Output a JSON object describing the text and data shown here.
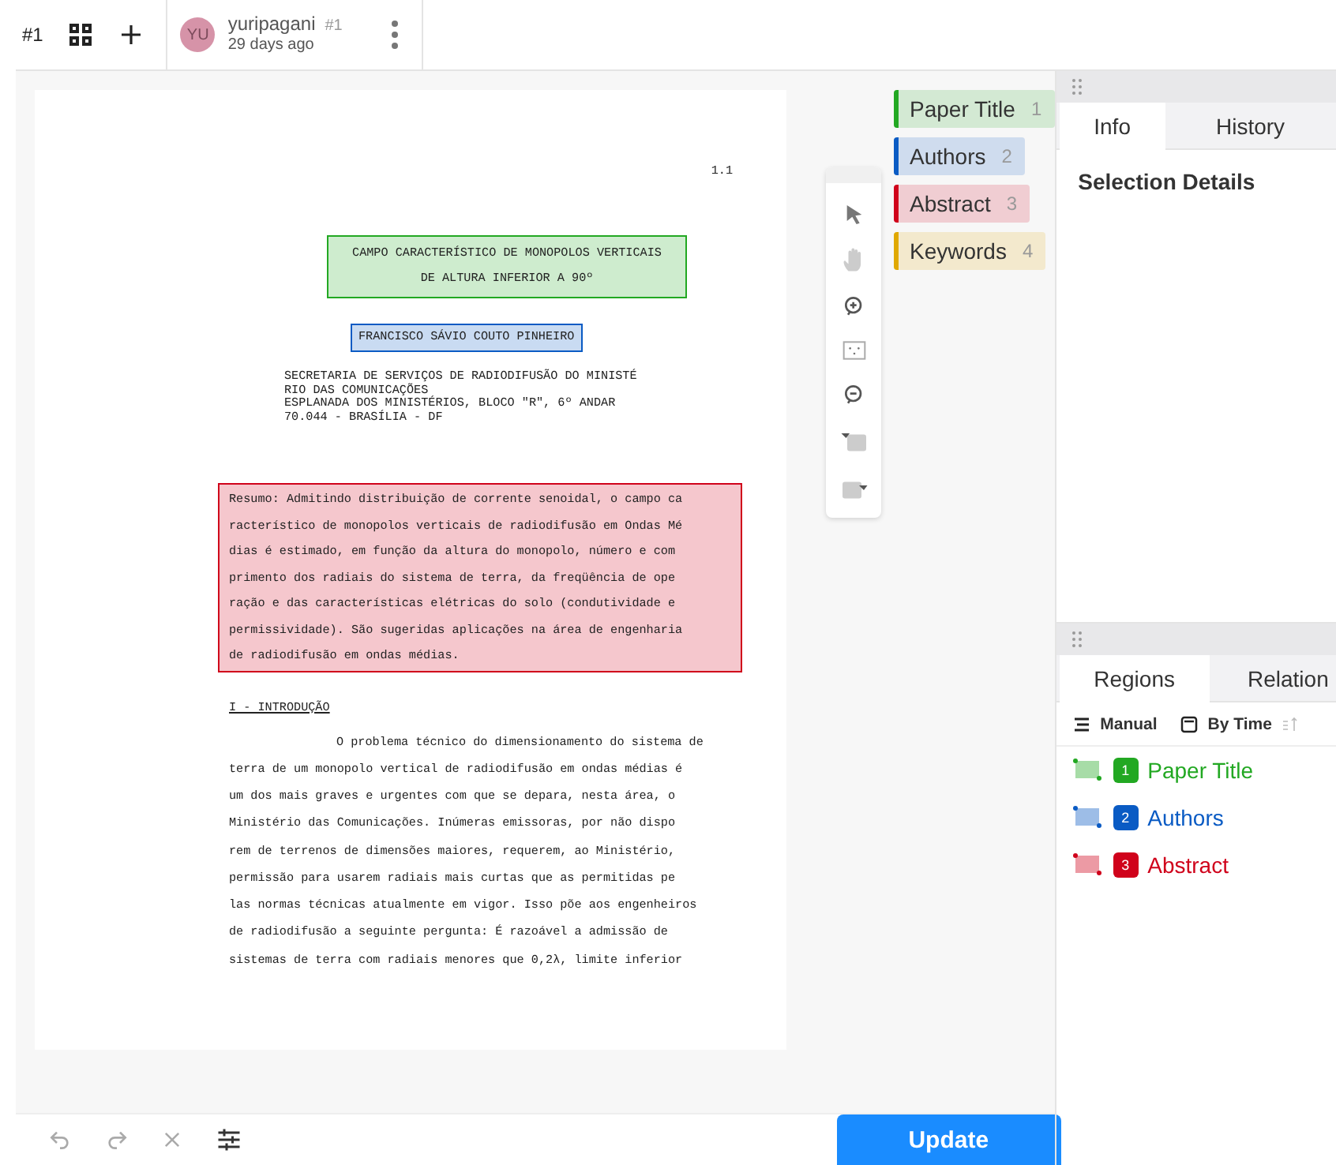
{
  "top_bar": {
    "annotation_id": "#1",
    "user": {
      "initials": "YU",
      "name": "yuripagani",
      "id": "#1",
      "time": "29 days ago"
    }
  },
  "document": {
    "page_number": "1.1",
    "blocks": [
      {
        "kind": "title",
        "color": "#22a822",
        "lines": [
          "CAMPO CARACTERÍSTICO DE MONOPOLOS VERTICAIS",
          "DE ALTURA INFERIOR A 90º"
        ]
      },
      {
        "kind": "authors",
        "color": "#0a5bc4",
        "lines": [
          "FRANCISCO SÁVIO COUTO PINHEIRO"
        ]
      },
      {
        "kind": "address",
        "lines": [
          "SECRETARIA DE SERVIÇOS DE RADIODIFUSÃO DO MINISTÉ",
          "RIO DAS COMUNICAÇÕES",
          "ESPLANADA DOS MINISTÉRIOS, BLOCO \"R\", 6º ANDAR",
          "70.044 - BRASÍLIA - DF"
        ]
      },
      {
        "kind": "abstract",
        "color": "#d0021b",
        "lines": [
          "Resumo: Admitindo distribuição de corrente senoidal, o campo ca",
          "racterístico de monopolos verticais de radiodifusão em Ondas Mé",
          "dias é estimado, em função da altura do monopolo, número e com",
          "primento dos radiais do sistema de terra, da freqüência de ope",
          "ração e das características elétricas do solo (condutividade e",
          "permissividade). São sugeridas aplicações na área de engenharia",
          "de radiodifusão em ondas médias."
        ]
      },
      {
        "kind": "heading",
        "lines": [
          "I - INTRODUÇÃO"
        ]
      },
      {
        "kind": "body",
        "lines": [
          "O problema técnico do dimensionamento do sistema de",
          "terra de um monopolo vertical de radiodifusão em ondas médias é",
          "um dos mais graves e urgentes com que se depara, nesta área, o",
          "Ministério das Comunicações. Inúmeras emissoras, por não dispo",
          "rem de terrenos de dimensões maiores, requerem, ao Ministério,",
          "permissão para usarem radiais mais curtas que as permitidas pe",
          "las normas técnicas atualmente em vigor. Isso põe aos engenheiros",
          "de radiodifusão a seguinte pergunta: É razoável a admissão de",
          "sistemas de terra com radiais menores que 0,2λ, limite inferior"
        ]
      }
    ]
  },
  "labels": [
    {
      "text": "Paper Title",
      "hotkey": "1",
      "color": "#22a822"
    },
    {
      "text": "Authors",
      "hotkey": "2",
      "color": "#0a5bc4"
    },
    {
      "text": "Abstract",
      "hotkey": "3",
      "color": "#d0021b"
    },
    {
      "text": "Keywords",
      "hotkey": "4",
      "color": "#e0a800"
    }
  ],
  "info_panel": {
    "tabs": [
      {
        "label": "Info",
        "selected": true
      },
      {
        "label": "History",
        "selected": false
      }
    ],
    "heading": "Selection Details"
  },
  "regions_panel": {
    "tabs": [
      {
        "label": "Regions",
        "selected": true
      },
      {
        "label": "Relation",
        "selected": false
      }
    ],
    "sort": {
      "order": "Manual",
      "by": "By Time"
    },
    "regions": [
      {
        "index": "1",
        "label": "Paper Title",
        "color": "#22a822"
      },
      {
        "index": "2",
        "label": "Authors",
        "color": "#0a5bc4"
      },
      {
        "index": "3",
        "label": "Abstract",
        "color": "#d0021b"
      }
    ]
  },
  "bottom_bar": {
    "submit": "Update"
  }
}
